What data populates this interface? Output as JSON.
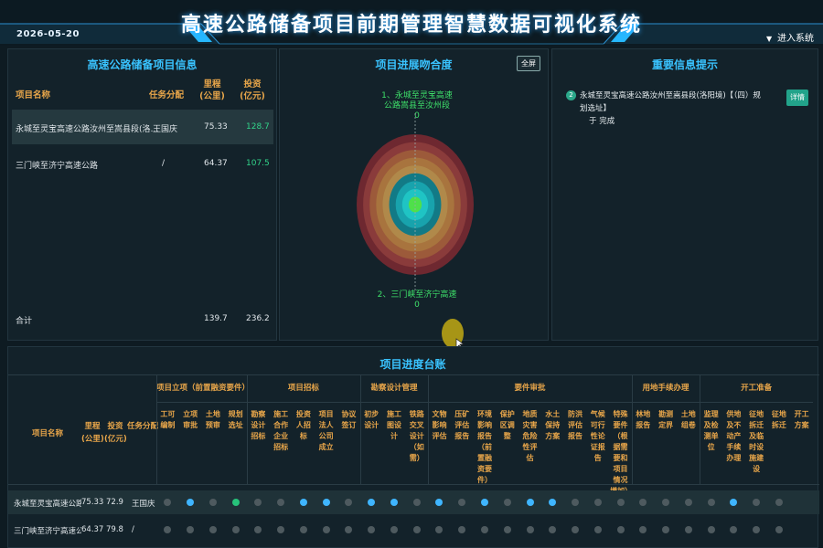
{
  "header": {
    "date": "2026-05-20",
    "title": "高速公路储备项目前期管理智慧数据可视化系统",
    "enter_label": "进入系统"
  },
  "left_panel": {
    "title": "高速公路储备项目信息",
    "columns": {
      "name": "项目名称",
      "task": "任务分配",
      "mileage": "里程\n(公里)",
      "invest": "投资\n(亿元)"
    },
    "rows": [
      {
        "name": "永城至灵宝高速公路汝州至嵩县段(洛…",
        "task": "王国庆",
        "mileage": "75.33",
        "invest": "128.7"
      },
      {
        "name": "三门峡至济宁高速公路",
        "task": "/",
        "mileage": "64.37",
        "invest": "107.5"
      }
    ],
    "total": {
      "label": "合计",
      "mileage": "139.7",
      "invest": "236.2"
    }
  },
  "mid_panel": {
    "title": "项目进展吻合度",
    "fullscreen_label": "全屏",
    "label1_line1": "1、永城至灵宝高速",
    "label1_line2": "公路嵩县至汝州段",
    "label1_value": "0",
    "label2_line1": "2、三门峡至济宁高速",
    "label2_value": "0",
    "ring_colors": [
      "#6e2830",
      "#8a3b3b",
      "#9c5a3a",
      "#a8743e",
      "#b0894a",
      "#127a86",
      "#18a3ad",
      "#1fc4c4",
      "#4fe04a"
    ]
  },
  "right_panel": {
    "title": "重要信息提示",
    "item_number": "2",
    "item_text_line1": "永城至灵宝高速公路汝州至嵩县段(洛阳境)【（四）规划选址】",
    "item_text_line2": "于 完成",
    "detail_button": "详情"
  },
  "bottom_panel": {
    "title": "项目进度台账",
    "fixed_cols": [
      "项目名称",
      "里程\n(公里)",
      "投资\n(亿元)",
      "任务分配"
    ],
    "groups": [
      {
        "name": "项目立项（前置融资要件）",
        "cols": [
          "工可编制",
          "立项审批",
          "土地预审",
          "规划选址"
        ]
      },
      {
        "name": "项目招标",
        "cols": [
          "勘察设计招标",
          "施工合作企业招标",
          "投资人招标",
          "项目法人公司成立",
          "协议签订"
        ]
      },
      {
        "name": "勘察设计管理",
        "cols": [
          "初步设计",
          "施工图设计",
          "铁路交叉设计（如需）"
        ]
      },
      {
        "name": "要件审批",
        "cols": [
          "文物影响评估",
          "压矿评估报告",
          "环境影响报告（前置融资要件）",
          "保护区调整",
          "地质灾害危险性评估",
          "水土保持方案",
          "防洪评估报告",
          "气候可行性论证报告",
          "特殊要件（根据需要和项目情况增加）"
        ]
      },
      {
        "name": "用地手续办理",
        "cols": [
          "林地报告",
          "勘测定界",
          "土地组卷"
        ]
      },
      {
        "name": "开工准备",
        "cols": [
          "监理及检测单位",
          "供地及不动产手续办理",
          "征地拆迁及临时设施建设",
          "征地拆迁",
          "开工方案"
        ]
      }
    ],
    "rows": [
      {
        "name": "永城至灵宝高速公路…",
        "mileage": "75.33",
        "invest": "72.9",
        "task": "王国庆",
        "status": [
          "grey",
          "blue",
          "grey",
          "green",
          "grey",
          "grey",
          "blue",
          "blue",
          "grey",
          "blue",
          "blue",
          "grey",
          "blue",
          "grey",
          "blue",
          "grey",
          "blue",
          "blue",
          "grey",
          "grey",
          "grey",
          "grey",
          "grey",
          "grey",
          "grey",
          "blue",
          "grey",
          "grey"
        ]
      },
      {
        "name": "三门峡至济宁高速公路",
        "mileage": "64.37",
        "invest": "79.8",
        "task": "/",
        "status": [
          "grey",
          "grey",
          "grey",
          "grey",
          "grey",
          "grey",
          "grey",
          "grey",
          "grey",
          "grey",
          "grey",
          "grey",
          "grey",
          "grey",
          "grey",
          "grey",
          "grey",
          "grey",
          "grey",
          "grey",
          "grey",
          "grey",
          "grey",
          "grey",
          "grey",
          "grey",
          "grey",
          "grey"
        ]
      }
    ],
    "status_colors": {
      "grey": "#4e5a5f",
      "blue": "#3fb5ff",
      "green": "#27c27a"
    }
  },
  "cursor_highlight_color": "#b8a214"
}
